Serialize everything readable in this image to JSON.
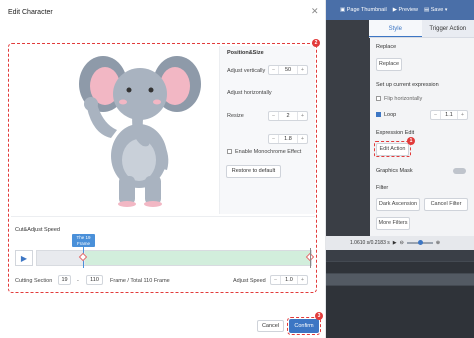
{
  "modal": {
    "title": "Edit Character",
    "close_icon": "close-icon",
    "badge_main": "2",
    "badge_confirm": "3"
  },
  "position_size": {
    "heading": "Position&Size",
    "adjust_vertically_label": "Adjust vertically",
    "adjust_vertically_value": "50",
    "adjust_horizontally_label": "Adjust horizontally",
    "resize_label": "Resize",
    "resize_value": "2",
    "second_value": "1.8",
    "monochrome_label": "Enable Monochrome Effect",
    "restore_button": "Restore to default",
    "minus": "−",
    "plus": "+"
  },
  "cut_speed": {
    "heading": "Cut&Adjust Speed",
    "frame_flag_line1": "The 19",
    "frame_flag_line2": "Frame",
    "cutting_section_label": "Cutting Section",
    "cut_start": "19",
    "cut_dash": "-",
    "cut_end": "110",
    "frame_total_label": "Frame / Total 110 Frame",
    "adjust_speed_label": "Adjust Speed",
    "speed_value": "1.0"
  },
  "footer": {
    "cancel": "Cancel",
    "confirm": "Confirm"
  },
  "background_editor": {
    "top_bar": {
      "page_thumbnail": "Page Thumbnail",
      "preview": "Preview",
      "save": "Save"
    },
    "tabs": [
      "Style",
      "Trigger Action"
    ],
    "sections": {
      "replace_heading": "Replace",
      "replace_button": "Replace",
      "expression_heading": "Set up current expression",
      "flip_horizontally": "Flip horizontally",
      "loop": "Loop",
      "loop_value": "1.1",
      "expression_edit_heading": "Expression Edit",
      "edit_action_button": "Edit Action",
      "badge": "1",
      "graphics_mask": "Graphics Mask",
      "filter": "Filter",
      "dark_ascension": "Dark Ascension",
      "cancel_filter": "Cancel Filter",
      "more_filters": "More Filters"
    },
    "timeline": {
      "zoom_text": "1.0610 s/0.2183 s"
    }
  },
  "colors": {
    "accent": "#3c76c4",
    "danger": "#e23b3b",
    "track_selection": "#d2eedc"
  }
}
